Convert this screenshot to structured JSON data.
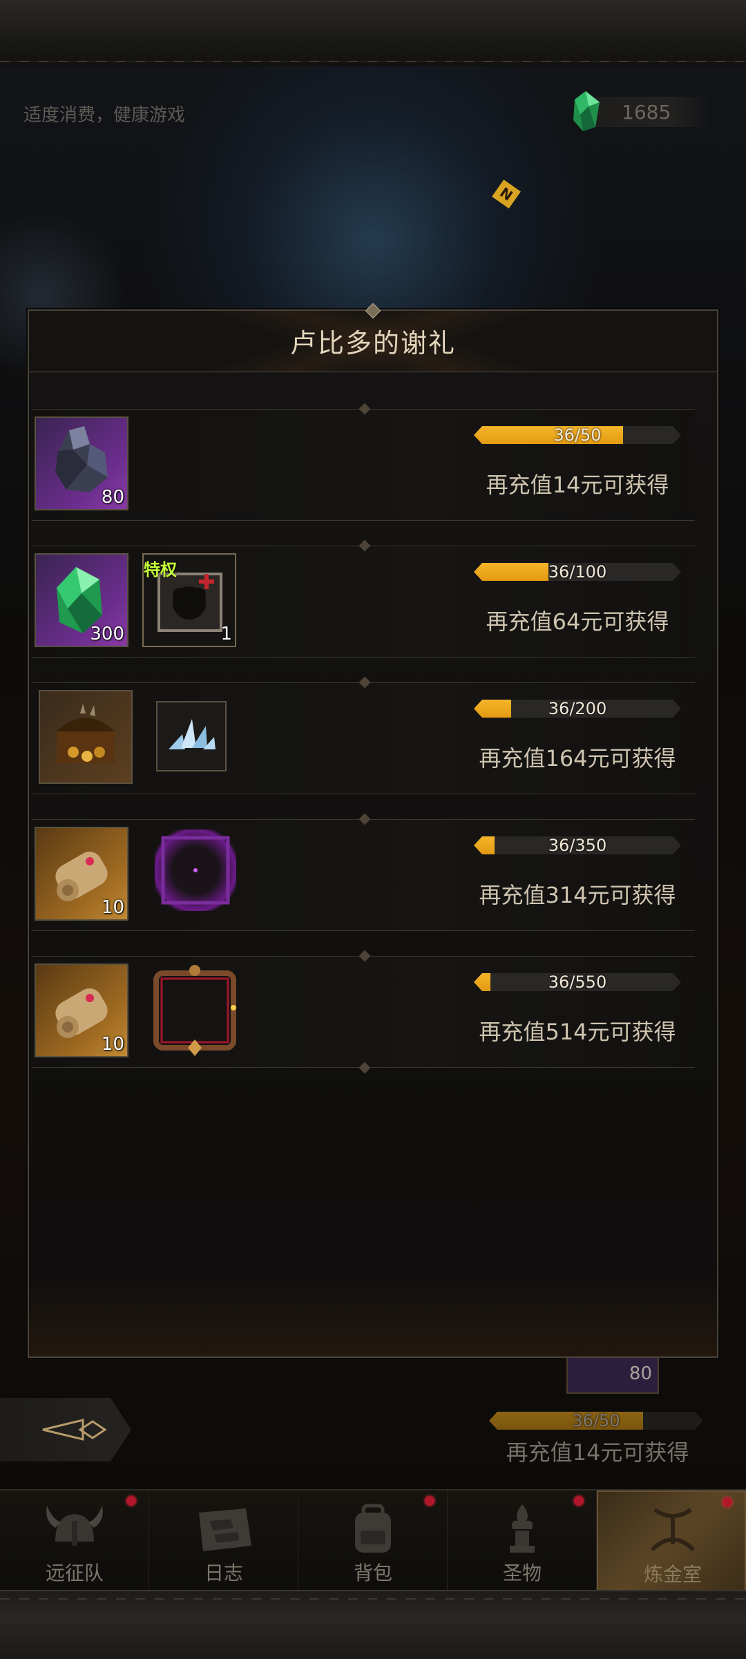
{
  "header": {
    "hint": "适度消费，健康游戏",
    "currency_count": "1685",
    "currency_icon": "green-crystal-icon"
  },
  "dialog": {
    "title": "卢比多的谢礼",
    "rows": [
      {
        "items": [
          {
            "icon": "ore-chunk-icon",
            "count": "80"
          }
        ],
        "progress_text": "36/50",
        "progress_fraction": 0.72,
        "status": "再充值14元可获得"
      },
      {
        "items": [
          {
            "icon": "green-crystal-icon",
            "count": "300"
          },
          {
            "icon": "privilege-card-icon",
            "badge": "特权",
            "count": "1"
          }
        ],
        "progress_text": "36/100",
        "progress_fraction": 0.36,
        "status": "再充值64元可获得"
      },
      {
        "items": [
          {
            "icon": "treasure-chest-icon"
          },
          {
            "icon": "ice-shard-icon"
          }
        ],
        "progress_text": "36/200",
        "progress_fraction": 0.18,
        "status": "再充值164元可获得"
      },
      {
        "items": [
          {
            "icon": "scroll-icon",
            "count": "10"
          },
          {
            "icon": "purple-frame-icon"
          }
        ],
        "progress_text": "36/350",
        "progress_fraction": 0.1,
        "status": "再充值314元可获得"
      },
      {
        "items": [
          {
            "icon": "scroll-icon",
            "count": "10"
          },
          {
            "icon": "ornate-frame-icon"
          }
        ],
        "progress_text": "36/550",
        "progress_fraction": 0.07,
        "status": "再充值514元可获得"
      }
    ]
  },
  "background_panel": {
    "slot_count": "80",
    "progress_text": "36/50",
    "progress_fraction": 0.72,
    "status": "再充值14元可获得"
  },
  "nav": {
    "tabs": [
      {
        "label": "远征队",
        "icon": "viking-helmet-icon",
        "badge": true
      },
      {
        "label": "日志",
        "icon": "map-scroll-icon",
        "badge": false
      },
      {
        "label": "背包",
        "icon": "backpack-icon",
        "badge": true
      },
      {
        "label": "圣物",
        "icon": "relic-icon",
        "badge": true
      },
      {
        "label": "炼金室",
        "icon": "alchemy-icon",
        "badge": true,
        "active": true
      }
    ]
  },
  "colors": {
    "progress_fill": "#f4b52a",
    "badge_red": "#b0172a",
    "privilege_badge": "#c6ff3a"
  }
}
